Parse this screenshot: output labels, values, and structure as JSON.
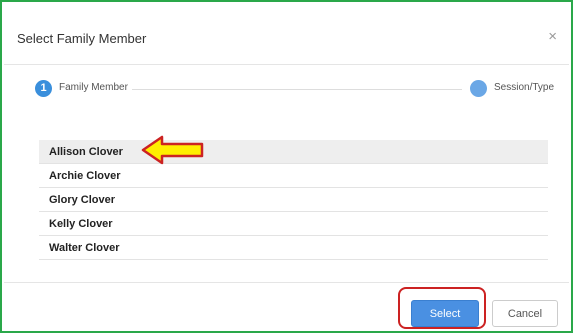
{
  "modal": {
    "title": "Select Family Member",
    "close_glyph": "×"
  },
  "stepper": {
    "steps": [
      {
        "number": "1",
        "label": "Family Member",
        "state": "active"
      },
      {
        "number": "",
        "label": "Session/Type",
        "state": "pending"
      }
    ]
  },
  "members": [
    {
      "name": "Allison Clover",
      "selected": true
    },
    {
      "name": "Archie Clover",
      "selected": false
    },
    {
      "name": "Glory Clover",
      "selected": false
    },
    {
      "name": "Kelly Clover",
      "selected": false
    },
    {
      "name": "Walter Clover",
      "selected": false
    }
  ],
  "footer": {
    "select_label": "Select",
    "cancel_label": "Cancel"
  },
  "colors": {
    "frame_border": "#2aa84a",
    "primary": "#4a90e2",
    "annotation_arrow_fill": "#ffee00",
    "annotation_arrow_stroke": "#cc2222",
    "annotation_highlight": "#cc2222"
  },
  "annotations": {
    "arrow_icon": "left-arrow-icon",
    "highlight": "select-button"
  }
}
